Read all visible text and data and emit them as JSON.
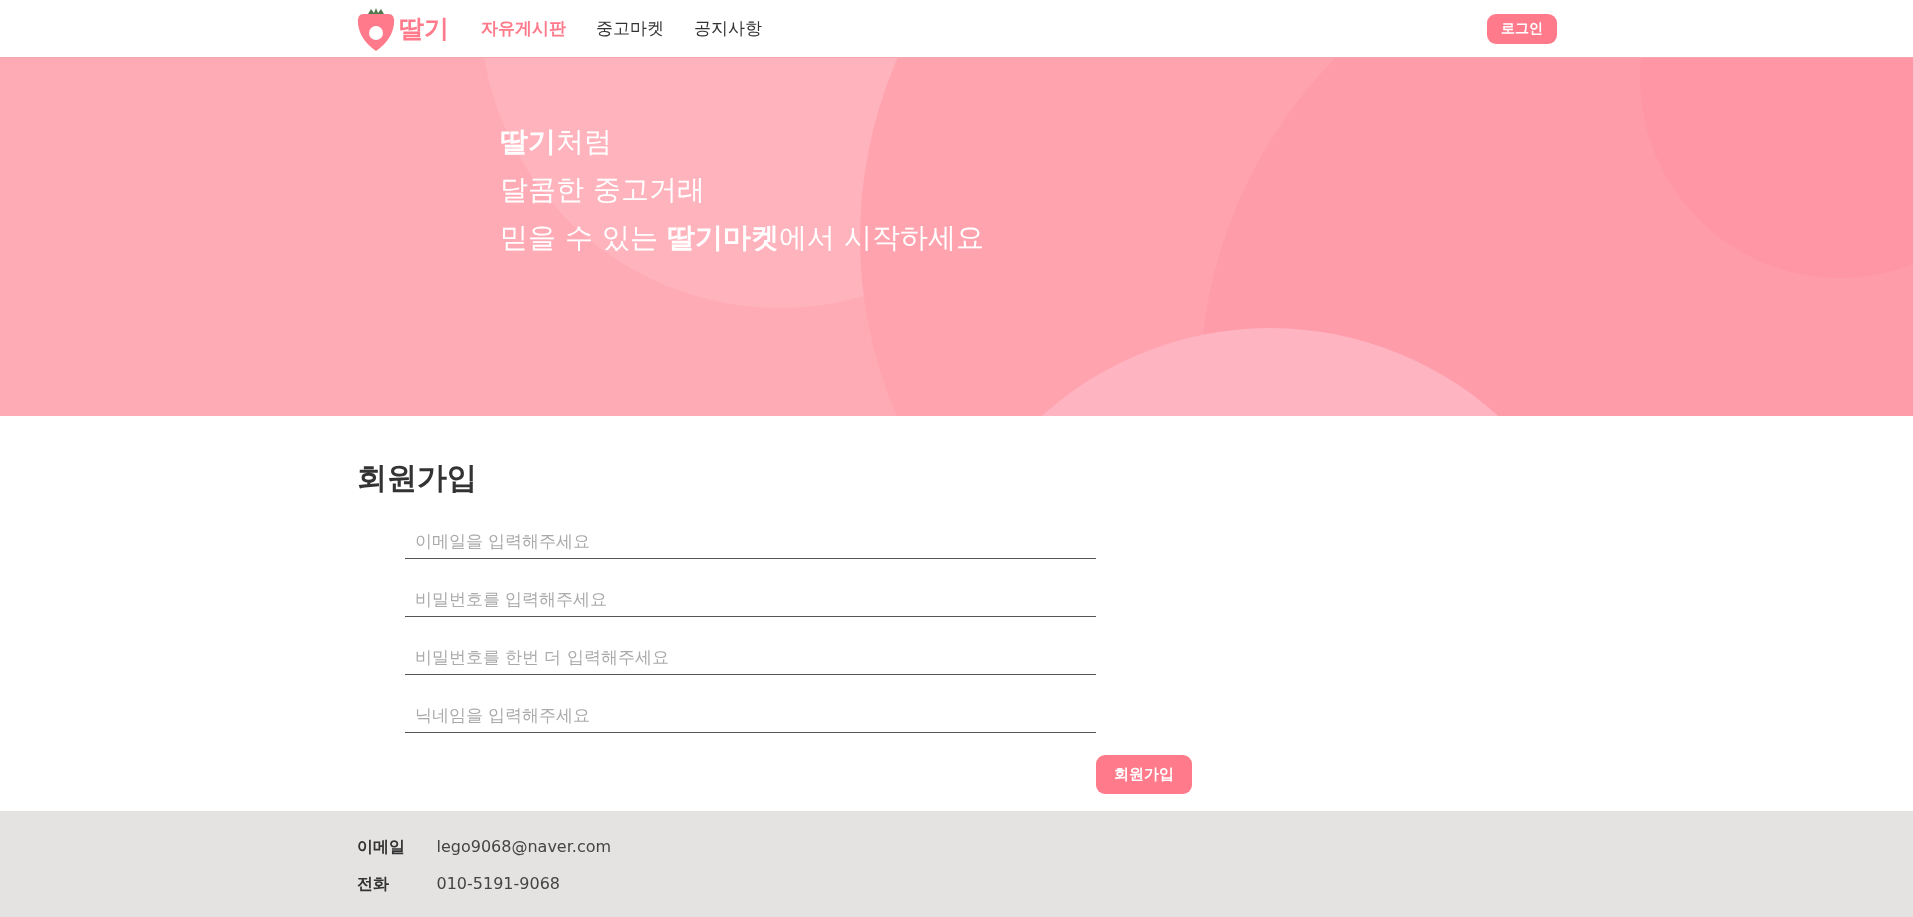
{
  "header": {
    "logo_text": "딸기",
    "nav": [
      {
        "label": "자유게시판",
        "selected": true
      },
      {
        "label": "중고마켓",
        "selected": false
      },
      {
        "label": "공지사항",
        "selected": false
      }
    ],
    "login_button": "로그인"
  },
  "hero": {
    "lines": [
      "**딸기**처럼",
      "달콤한 중고거래",
      "믿을 수 있는 **딸기마켓**에서 시작하세요"
    ]
  },
  "signup": {
    "title": "회원가입",
    "fields": [
      {
        "placeholder": "이메일을 입력해주세요"
      },
      {
        "placeholder": "비밀번호를 입력해주세요"
      },
      {
        "placeholder": "비밀번호를 한번 더 입력해주세요"
      },
      {
        "placeholder": "닉네임을 입력해주세요"
      }
    ],
    "submit": "회원가입"
  },
  "footer": {
    "rows": [
      {
        "label": "이메일",
        "value": "lego9068@naver.com"
      },
      {
        "label": "전화",
        "value": "010-5191-9068"
      }
    ]
  }
}
